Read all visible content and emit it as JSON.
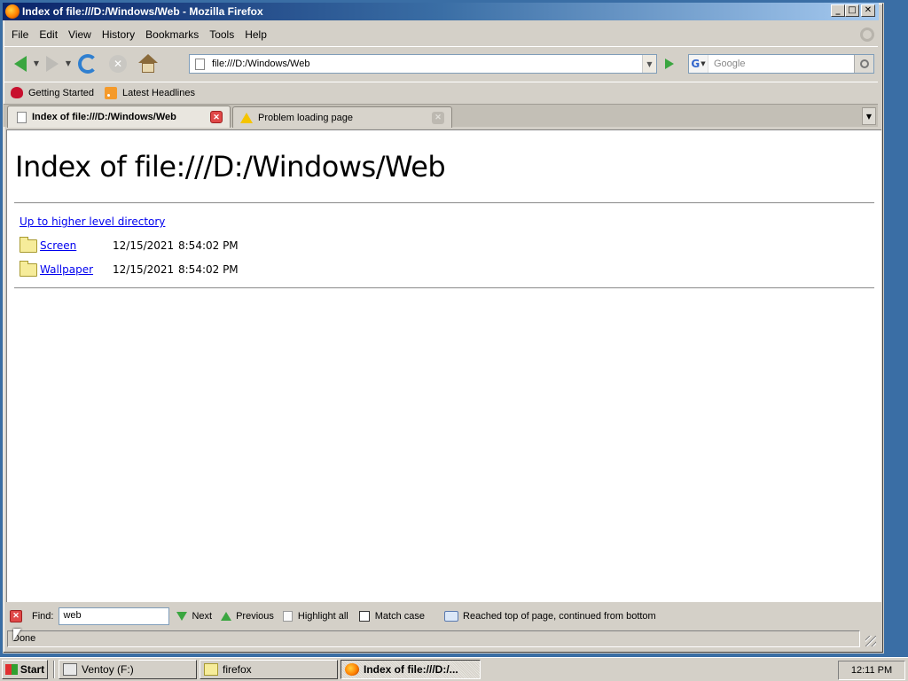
{
  "window": {
    "title": "Index of file:///D:/Windows/Web - Mozilla Firefox",
    "min_label": "_",
    "max_label": "□",
    "close_label": "✕"
  },
  "menubar": {
    "items": [
      "File",
      "Edit",
      "View",
      "History",
      "Bookmarks",
      "Tools",
      "Help"
    ]
  },
  "navbar": {
    "url": "file:///D:/Windows/Web",
    "search_placeholder": "Google",
    "search_engine_letter": "G"
  },
  "bookmarks": {
    "items": [
      "Getting Started",
      "Latest Headlines"
    ]
  },
  "tabs": [
    {
      "label": "Index of file:///D:/Windows/Web",
      "active": true
    },
    {
      "label": "Problem loading page",
      "active": false
    }
  ],
  "page": {
    "heading": "Index of file:///D:/Windows/Web",
    "up_link": "Up to higher level directory",
    "entries": [
      {
        "name": "Screen",
        "date": "12/15/2021",
        "time": "8:54:02 PM"
      },
      {
        "name": "Wallpaper",
        "date": "12/15/2021",
        "time": "8:54:02 PM"
      }
    ]
  },
  "findbar": {
    "label": "Find:",
    "value": "web",
    "next": "Next",
    "previous": "Previous",
    "highlight_all": "Highlight all",
    "match_case": "Match case",
    "status": "Reached top of page, continued from bottom"
  },
  "statusbar": {
    "text": "Done"
  },
  "taskbar": {
    "start": "Start",
    "tasks": [
      "Ventoy (F:)",
      "firefox",
      "Index of file:///D:/..."
    ],
    "clock": "12:11 PM"
  },
  "colors": {
    "link": "#0000ee",
    "titlebar_start": "#0a246a",
    "titlebar_end": "#a6caf0",
    "desktop": "#3a6ea5"
  }
}
